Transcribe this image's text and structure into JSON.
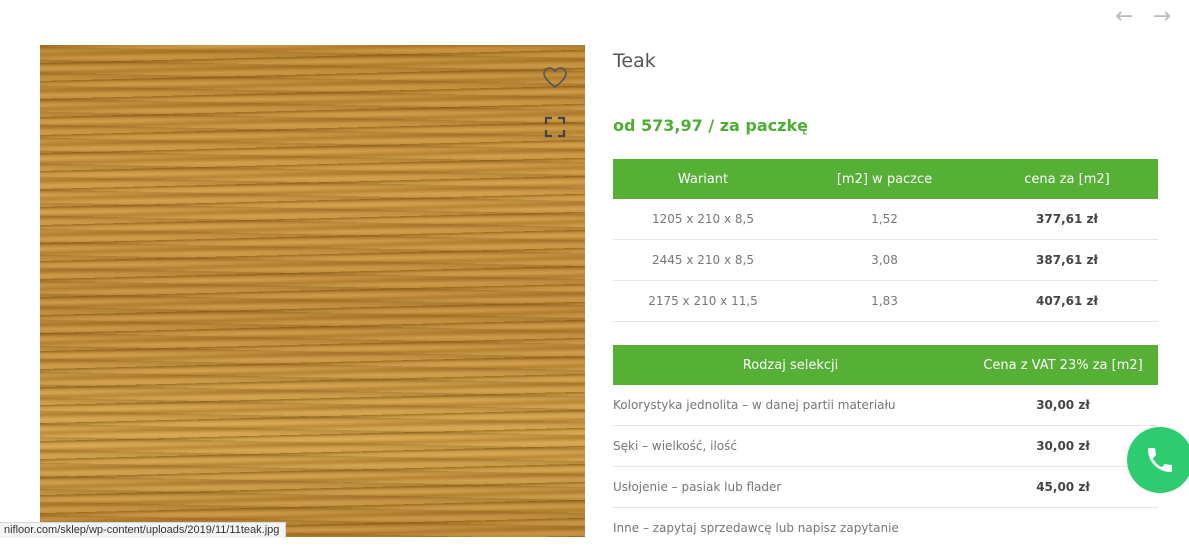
{
  "nav": {
    "prev_arrow": "←",
    "next_arrow": "→"
  },
  "product": {
    "title": "Teak",
    "price": "od 573,97  / za paczkę"
  },
  "variants_table": {
    "headers": [
      "Wariant",
      "[m2] w paczce",
      "cena za [m2]"
    ],
    "rows": [
      [
        "1205 x 210 x 8,5",
        "1,52",
        "377,61 zł"
      ],
      [
        "2445 x 210 x 8,5",
        "3,08",
        "387,61 zł"
      ],
      [
        "2175 x 210 x 11,5",
        "1,83",
        "407,61 zł"
      ]
    ]
  },
  "selection_table": {
    "headers": [
      "Rodzaj selekcji",
      "Cena z VAT 23% za [m2]"
    ],
    "rows": [
      [
        "Kolorystyka jednolita – w danej partii materiału",
        "30,00 zł"
      ],
      [
        "Sęki – wielkość, ilość",
        "30,00 zł"
      ],
      [
        "Usłojenie – pasiak lub flader",
        "45,00 zł"
      ],
      [
        "Inne – zapytaj sprzedawcę lub napisz zapytanie",
        ""
      ]
    ]
  },
  "status_bar": {
    "url": "nifloor.com/sklep/wp-content/uploads/2019/11/11teak.jpg"
  },
  "icons": {
    "heart": "heart-icon",
    "fullscreen": "fullscreen-icon",
    "phone": "phone-icon"
  },
  "colors": {
    "accent_green": "#55b035",
    "price_green": "#4caf30",
    "phone_green": "#2ecc71"
  }
}
